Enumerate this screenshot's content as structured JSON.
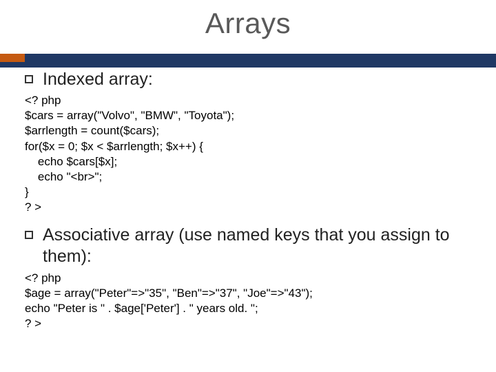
{
  "title": "Arrays",
  "items": [
    {
      "heading": "Indexed array:",
      "code": "<? php\n$cars = array(\"Volvo\", \"BMW\", \"Toyota\");\n$arrlength = count($cars);\nfor($x = 0; $x < $arrlength; $x++) {\n    echo $cars[$x];\n    echo \"<br>\";\n}\n? >"
    },
    {
      "heading": "Associative array (use named keys that you assign to them):",
      "code": "<? php\n$age = array(\"Peter\"=>\"35\", \"Ben\"=>\"37\", \"Joe\"=>\"43\");\necho \"Peter is \" . $age['Peter'] . \" years old. \";\n? >"
    }
  ]
}
